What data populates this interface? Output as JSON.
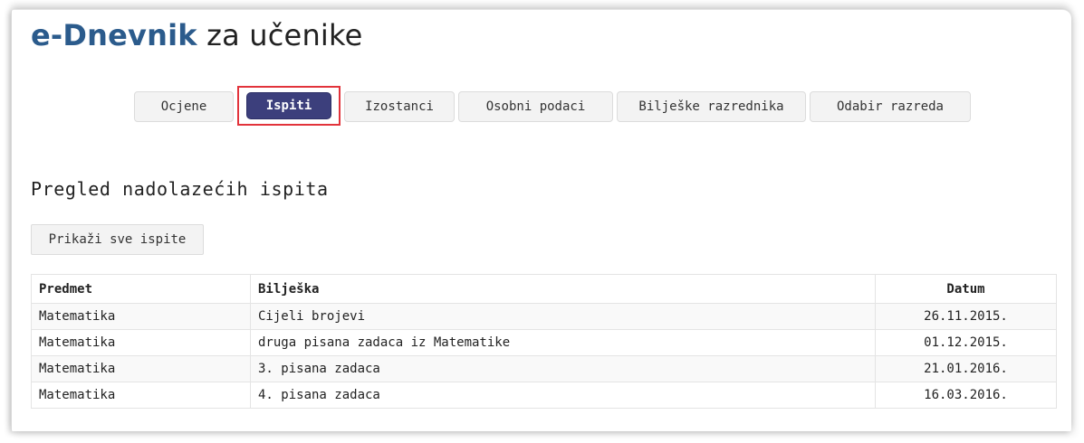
{
  "header": {
    "brand": "e-Dnevnik",
    "subtitle": "za učenike"
  },
  "tabs": [
    {
      "label": "Ocjene",
      "active": false
    },
    {
      "label": "Ispiti",
      "active": true
    },
    {
      "label": "Izostanci",
      "active": false
    },
    {
      "label": "Osobni podaci",
      "active": false
    },
    {
      "label": "Bilješke razrednika",
      "active": false
    },
    {
      "label": "Odabir razreda",
      "active": false
    }
  ],
  "main": {
    "section_title": "Pregled nadolazećih ispita",
    "show_all_label": "Prikaži sve ispite",
    "table": {
      "columns": [
        "Predmet",
        "Bilješka",
        "Datum"
      ],
      "rows": [
        [
          "Matematika",
          "Cijeli brojevi",
          "26.11.2015."
        ],
        [
          "Matematika",
          "druga pisana zadaca iz Matematike",
          "01.12.2015."
        ],
        [
          "Matematika",
          "3. pisana zadaca",
          "21.01.2016."
        ],
        [
          "Matematika",
          "4. pisana zadaca",
          "16.03.2016."
        ]
      ]
    }
  },
  "colors": {
    "brand": "#2b5b8c",
    "active_tab": "#3c3f7c",
    "highlight": "#e2333b"
  }
}
